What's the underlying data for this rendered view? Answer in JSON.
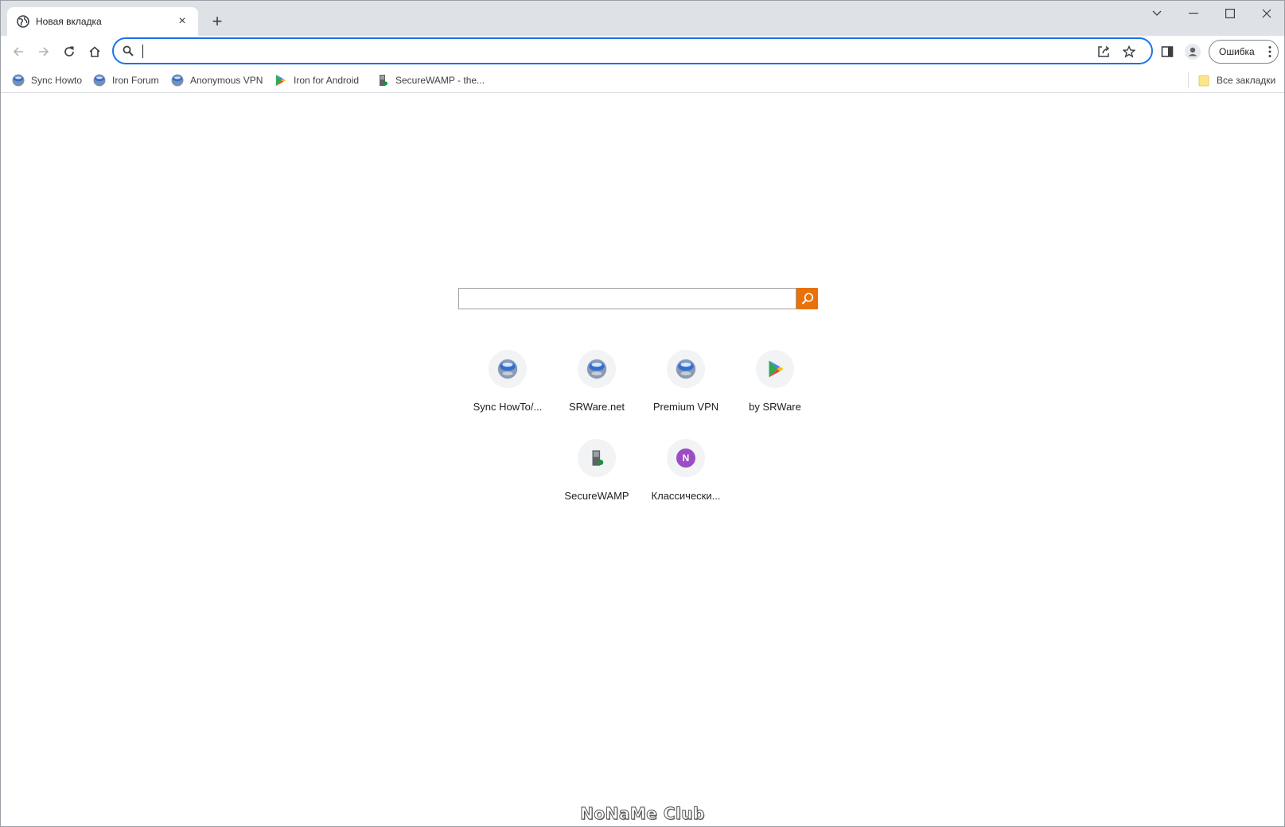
{
  "tab": {
    "title": "Новая вкладка",
    "close": "×"
  },
  "new_tab": "+",
  "window_controls": {
    "list": "⌄",
    "minimize": "—",
    "maximize": "☐",
    "close": "✕"
  },
  "omnibox": {
    "value": "",
    "placeholder": ""
  },
  "profile": {
    "label": "Ошибка"
  },
  "bookmarks": [
    {
      "label": "Sync Howto",
      "icon": "iron-globe-icon"
    },
    {
      "label": "Iron Forum",
      "icon": "iron-globe-icon"
    },
    {
      "label": "Anonymous VPN",
      "icon": "iron-globe-icon"
    },
    {
      "label": "Iron for Android",
      "icon": "play-store-icon"
    },
    {
      "label": "SecureWAMP - the...",
      "icon": "securewamp-icon"
    }
  ],
  "all_bookmarks": "Все закладки",
  "search": {
    "value": ""
  },
  "shortcuts": [
    {
      "label": "Sync HowTo/...",
      "icon": "iron-globe-icon"
    },
    {
      "label": "SRWare.net",
      "icon": "iron-globe-icon"
    },
    {
      "label": "Premium VPN",
      "icon": "iron-globe-icon"
    },
    {
      "label": "by SRWare",
      "icon": "play-store-icon"
    },
    {
      "label": "SecureWAMP",
      "icon": "securewamp-icon"
    },
    {
      "label": "Классически...",
      "icon": "letter-n-icon",
      "letter": "N"
    }
  ],
  "watermark": "NoNaMe Club",
  "colors": {
    "accent": "#1a73e8",
    "search_button": "#e8710a",
    "n_avatar": "#9c4dc4",
    "tabstrip": "#dee1e6"
  }
}
